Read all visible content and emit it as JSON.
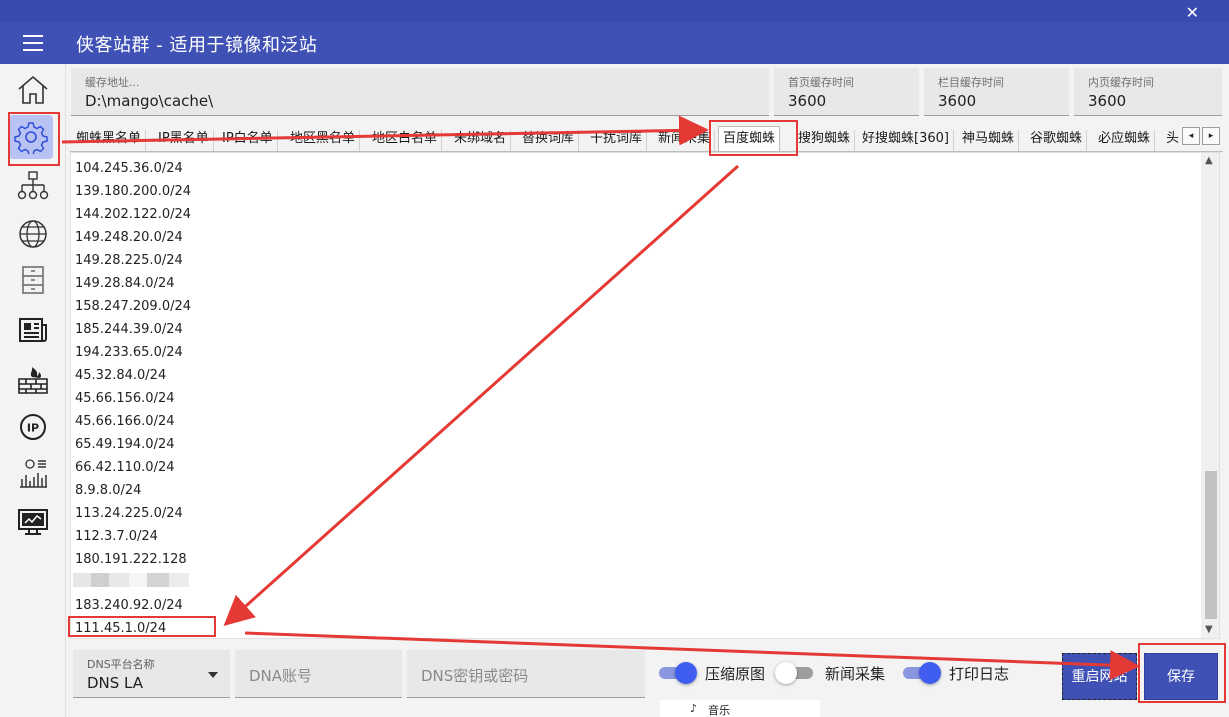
{
  "window": {
    "title": "侠客站群 - 适用于镜像和泛站",
    "close_glyph": "✕"
  },
  "rail": {
    "items": [
      {
        "icon": "home-icon"
      },
      {
        "icon": "gear-icon"
      },
      {
        "icon": "sitemap-icon"
      },
      {
        "icon": "globe-icon"
      },
      {
        "icon": "cabinet-icon"
      },
      {
        "icon": "newspaper-icon"
      },
      {
        "icon": "firewall-icon"
      },
      {
        "icon": "ip-icon"
      },
      {
        "icon": "stats-icon"
      },
      {
        "icon": "monitor-icon"
      }
    ]
  },
  "cache": {
    "path_label": "缓存地址...",
    "path_value": "D:\\mango\\cache\\",
    "home_label": "首页缓存时间",
    "home_value": "3600",
    "column_label": "栏目缓存时间",
    "column_value": "3600",
    "inner_label": "内页缓存时间",
    "inner_value": "3600"
  },
  "tabs": [
    "蜘蛛黑名单",
    "IP黑名单",
    "IP白名单",
    "地区黑名单",
    "地区白名单",
    "未绑域名",
    "替换词库",
    "干扰词库",
    "新闻采集",
    "百度蜘蛛",
    "搜狗蜘蛛",
    "好搜蜘蛛[360]",
    "神马蜘蛛",
    "谷歌蜘蛛",
    "必应蜘蛛",
    "头"
  ],
  "tab_scroll": {
    "left": "◂",
    "right": "▸"
  },
  "editor": {
    "lines": [
      "104.245.36.0/24",
      "139.180.200.0/24",
      "144.202.122.0/24",
      "149.248.20.0/24",
      "149.28.225.0/24",
      "149.28.84.0/24",
      "158.247.209.0/24",
      "185.244.39.0/24",
      "194.233.65.0/24",
      "45.32.84.0/24",
      "45.66.156.0/24",
      "45.66.166.0/24",
      "65.49.194.0/24",
      "66.42.110.0/24",
      "8.9.8.0/24",
      "113.24.225.0/24",
      "112.3.7.0/24",
      "180.191.222.128",
      "",
      "183.240.92.0/24",
      "111.45.1.0/24"
    ],
    "scroll_up": "▲",
    "scroll_down": "▼"
  },
  "dns": {
    "platform_label": "DNS平台名称",
    "platform_value": "DNS LA",
    "account_placeholder": "DNA账号",
    "secret_placeholder": "DNS密钥或密码"
  },
  "toggles": {
    "compress": {
      "label": "压缩原图",
      "on": true
    },
    "news": {
      "label": "新闻采集",
      "on": false
    },
    "log": {
      "label": "打印日志",
      "on": true
    }
  },
  "buttons": {
    "restart": "重启网站",
    "save": "保存"
  },
  "taskbar_fragment": {
    "text": "音乐",
    "note": "♪"
  },
  "colors": {
    "primary": "#3f51b5",
    "annotation_red": "#e53935",
    "toggle_on": "#3f5ef0"
  }
}
